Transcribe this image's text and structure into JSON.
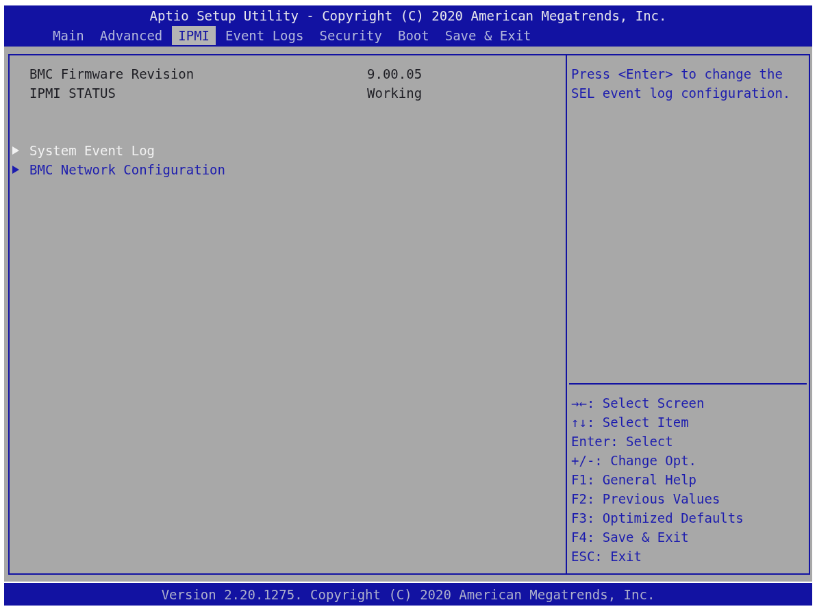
{
  "window": {
    "title": "Aptio Setup Utility - Copyright (C) 2020 American Megatrends, Inc."
  },
  "tabs": [
    {
      "label": "Main",
      "selected": false
    },
    {
      "label": "Advanced",
      "selected": false
    },
    {
      "label": "IPMI",
      "selected": true
    },
    {
      "label": "Event Logs",
      "selected": false
    },
    {
      "label": "Security",
      "selected": false
    },
    {
      "label": "Boot",
      "selected": false
    },
    {
      "label": "Save & Exit",
      "selected": false
    }
  ],
  "info_rows": [
    {
      "label": "BMC Firmware Revision",
      "value": "9.00.05"
    },
    {
      "label": "IPMI STATUS",
      "value": "Working"
    }
  ],
  "submenus": [
    {
      "label": "System Event Log",
      "selected": true
    },
    {
      "label": "BMC Network Configuration",
      "selected": false
    }
  ],
  "help_text": "Press <Enter> to change the SEL event log configuration.",
  "key_hints": [
    "→←: Select Screen",
    "↑↓: Select Item",
    "Enter: Select",
    "+/-: Change Opt.",
    "F1: General Help",
    "F2: Previous Values",
    "F3: Optimized Defaults",
    "F4: Save & Exit",
    "ESC: Exit"
  ],
  "footer": "Version 2.20.1275. Copyright (C) 2020 American Megatrends, Inc."
}
